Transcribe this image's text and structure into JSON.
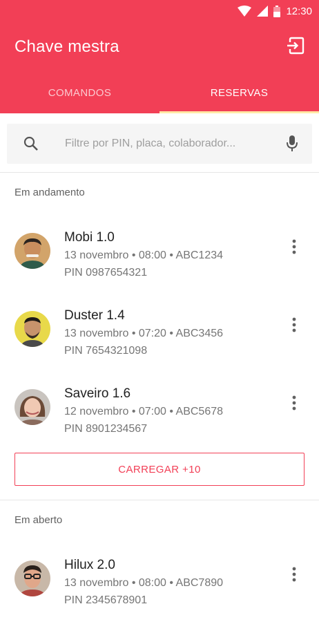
{
  "status_bar": {
    "time": "12:30"
  },
  "app": {
    "title": "Chave mestra"
  },
  "tabs": [
    {
      "label": "COMANDOS",
      "active": false
    },
    {
      "label": "RESERVAS",
      "active": true
    }
  ],
  "search": {
    "placeholder": "Filtre por PIN, placa, colaborador...",
    "value": ""
  },
  "sections": {
    "in_progress": {
      "title": "Em andamento",
      "items": [
        {
          "title": "Mobi 1.0",
          "subtitle": "13 novembro • 08:00 • ABC1234",
          "pin": "PIN 0987654321"
        },
        {
          "title": "Duster 1.4",
          "subtitle": "13 novembro • 07:20 • ABC3456",
          "pin": "PIN 7654321098"
        },
        {
          "title": "Saveiro 1.6",
          "subtitle": "12 novembro • 07:00 • ABC5678",
          "pin": "PIN 8901234567"
        }
      ],
      "load_more_label": "CARREGAR +10"
    },
    "open": {
      "title": "Em aberto",
      "items": [
        {
          "title": "Hilux 2.0",
          "subtitle": "13 novembro • 08:00 • ABC7890",
          "pin": "PIN 2345678901"
        }
      ]
    }
  },
  "colors": {
    "primary": "#F23F56",
    "tab_indicator": "#FFE9A6",
    "header_text": "#FFFFFF"
  },
  "icons": [
    "wifi-icon",
    "signal-icon",
    "battery-icon",
    "logout-icon",
    "search-icon",
    "mic-icon",
    "more-vert-icon"
  ]
}
